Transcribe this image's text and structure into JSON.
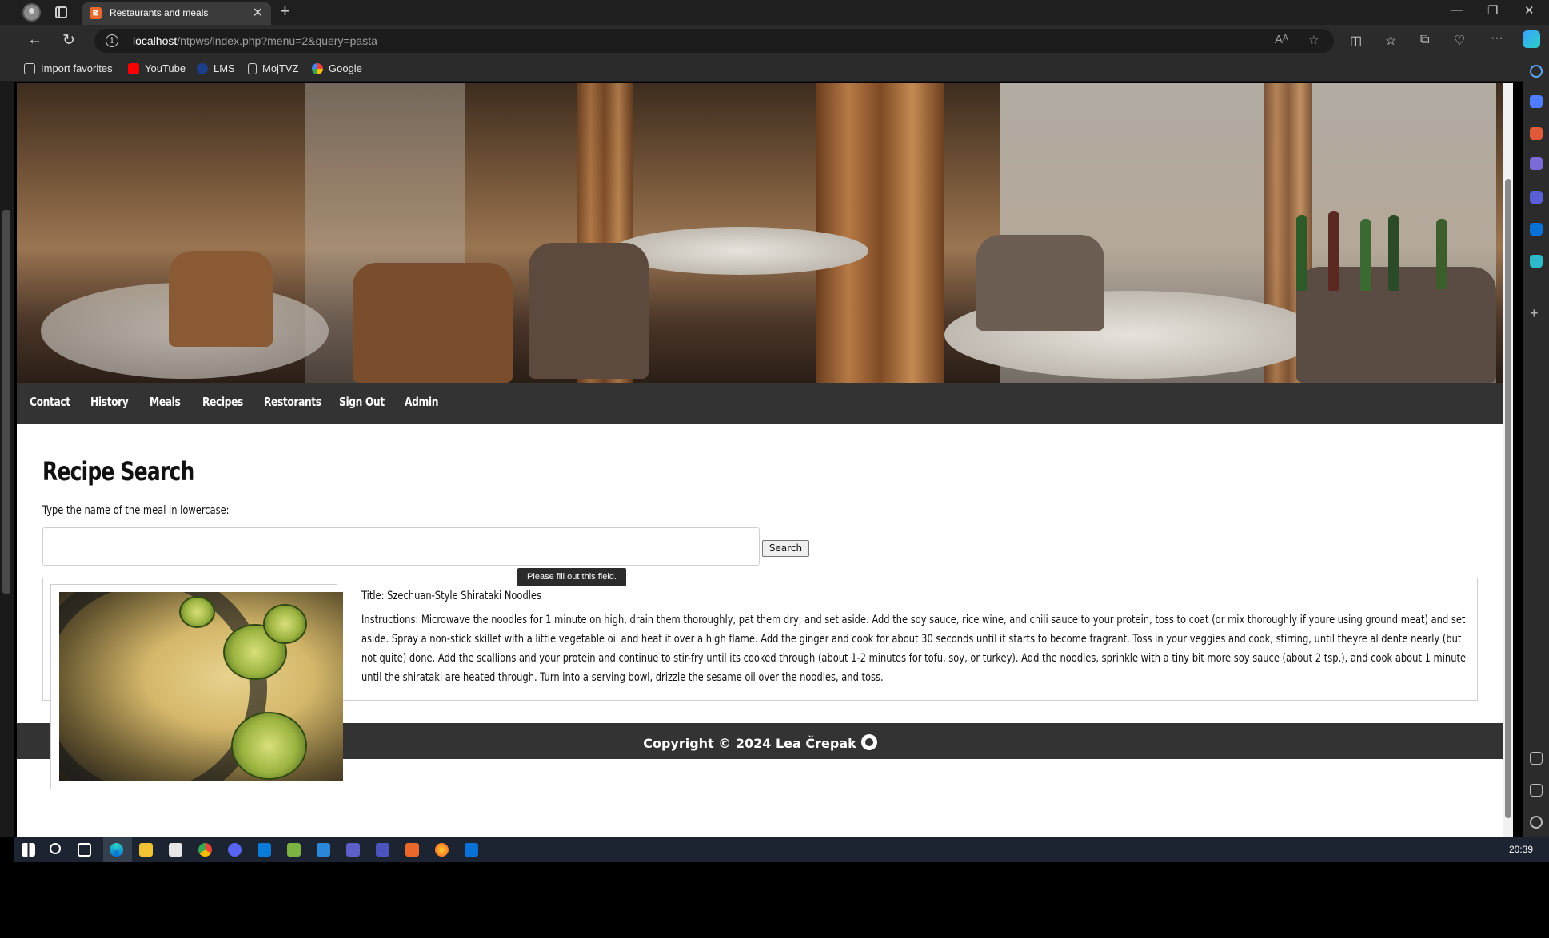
{
  "browser": {
    "tab_title": "Restaurants and meals",
    "url_host": "localhost",
    "url_path": "/ntpws/index.php?menu=2&query=pasta"
  },
  "bookmarks": [
    {
      "label": "Import favorites",
      "icon": "import-icon"
    },
    {
      "label": "YouTube",
      "icon": "youtube-icon"
    },
    {
      "label": "LMS",
      "icon": "lms-icon"
    },
    {
      "label": "MojTVZ",
      "icon": "page-icon"
    },
    {
      "label": "Google",
      "icon": "google-icon"
    }
  ],
  "nav": {
    "items": [
      "Contact",
      "History",
      "Meals",
      "Recipes",
      "Restorants",
      "Sign Out",
      "Admin"
    ]
  },
  "search": {
    "heading": "Recipe Search",
    "prompt": "Type the name of the meal in lowercase:",
    "input_value": "",
    "button_label": "Search",
    "validation_tooltip": "Please fill out this field."
  },
  "result": {
    "title": "Title: Szechuan-Style Shirataki Noodles",
    "instructions": "Instructions: Microwave the noodles for 1 minute on high, drain them thoroughly, pat them dry, and set aside. Add the soy sauce, rice wine, and chili sauce to your protein, toss to coat (or mix thoroughly if youre using ground meat) and set aside. Spray a non-stick skillet with a little vegetable oil and heat it over a high flame. Add the ginger and cook for about 30 seconds until it starts to become fragrant. Toss in your veggies and cook, stirring, until theyre al dente nearly (but not quite) done. Add the scallions and your protein and continue to stir-fry until its cooked through (about 1-2 minutes for tofu, soy, or turkey). Add the noodles, sprinkle with a tiny bit more soy sauce (about 2 tsp.), and cook about 1 minute until the shirataki are heated through. Turn into a serving bowl, drizzle the sesame oil over the noodles, and toss."
  },
  "footer": {
    "text": "Copyright © 2024 Lea Črepak"
  },
  "taskbar": {
    "clock": "20:39"
  }
}
